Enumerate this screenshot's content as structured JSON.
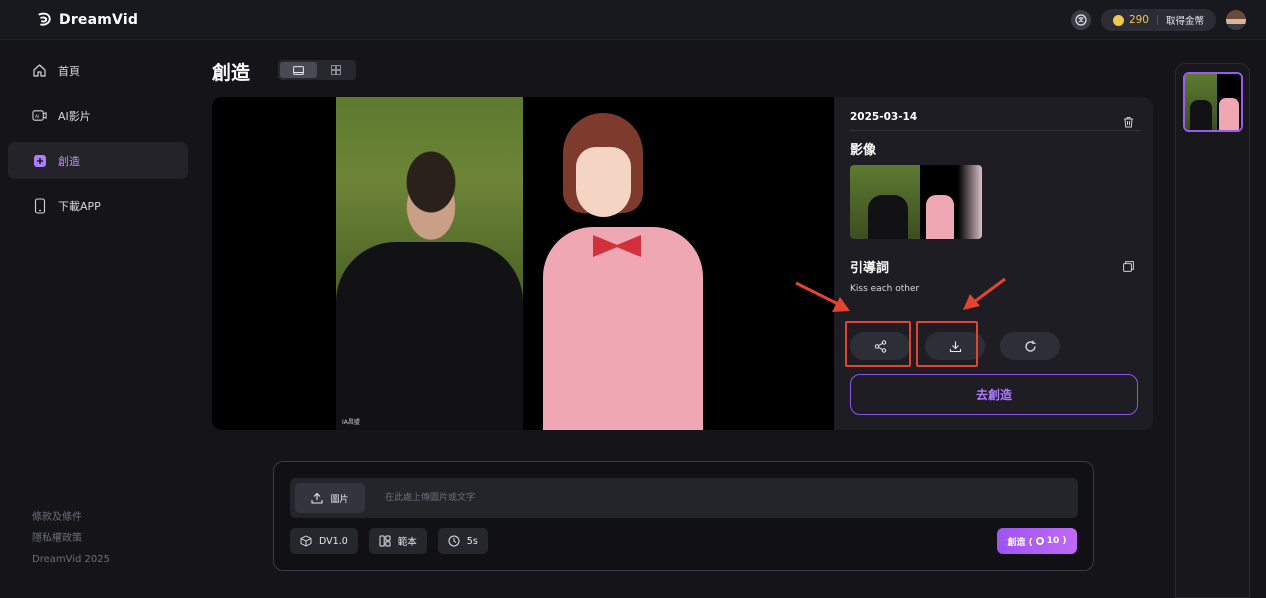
{
  "app": {
    "name": "DreamVid"
  },
  "header": {
    "coins": "290",
    "get_coins_label": "取得金幣",
    "icons": [
      "logo-icon",
      "language-icon",
      "coin-icon",
      "avatar"
    ]
  },
  "sidebar": {
    "items": [
      {
        "label": "首頁",
        "icon": "home-icon",
        "active": false
      },
      {
        "label": "AI影片",
        "icon": "ai-video-icon",
        "active": false
      },
      {
        "label": "創造",
        "icon": "create-icon",
        "active": true
      },
      {
        "label": "下載APP",
        "icon": "phone-icon",
        "active": false
      }
    ],
    "footer": {
      "terms": "條款及條件",
      "privacy": "隱私權政策",
      "copyright": "DreamVid 2025"
    }
  },
  "page": {
    "title": "創造",
    "view_modes": [
      "single-view-icon",
      "grid-view-icon"
    ]
  },
  "result": {
    "date": "2025-03-14",
    "image_section_label": "影像",
    "prompt_section_label": "引導詞",
    "prompt_text": "Kiss each other",
    "watermark": "IA昌盟",
    "actions": [
      "share-icon",
      "download-icon",
      "regenerate-icon"
    ],
    "create_again_label": "去創造"
  },
  "composer": {
    "upload_label": "圖片",
    "placeholder": "在此處上傳圖片或文字",
    "model_label": "DV1.0",
    "template_label": "範本",
    "duration_label": "5s",
    "create_label": "創造 (",
    "create_cost": "10",
    "create_suffix": ")"
  },
  "colors": {
    "accent": "#a65cf4",
    "annotation": "#e2442f",
    "background": "#141419"
  }
}
